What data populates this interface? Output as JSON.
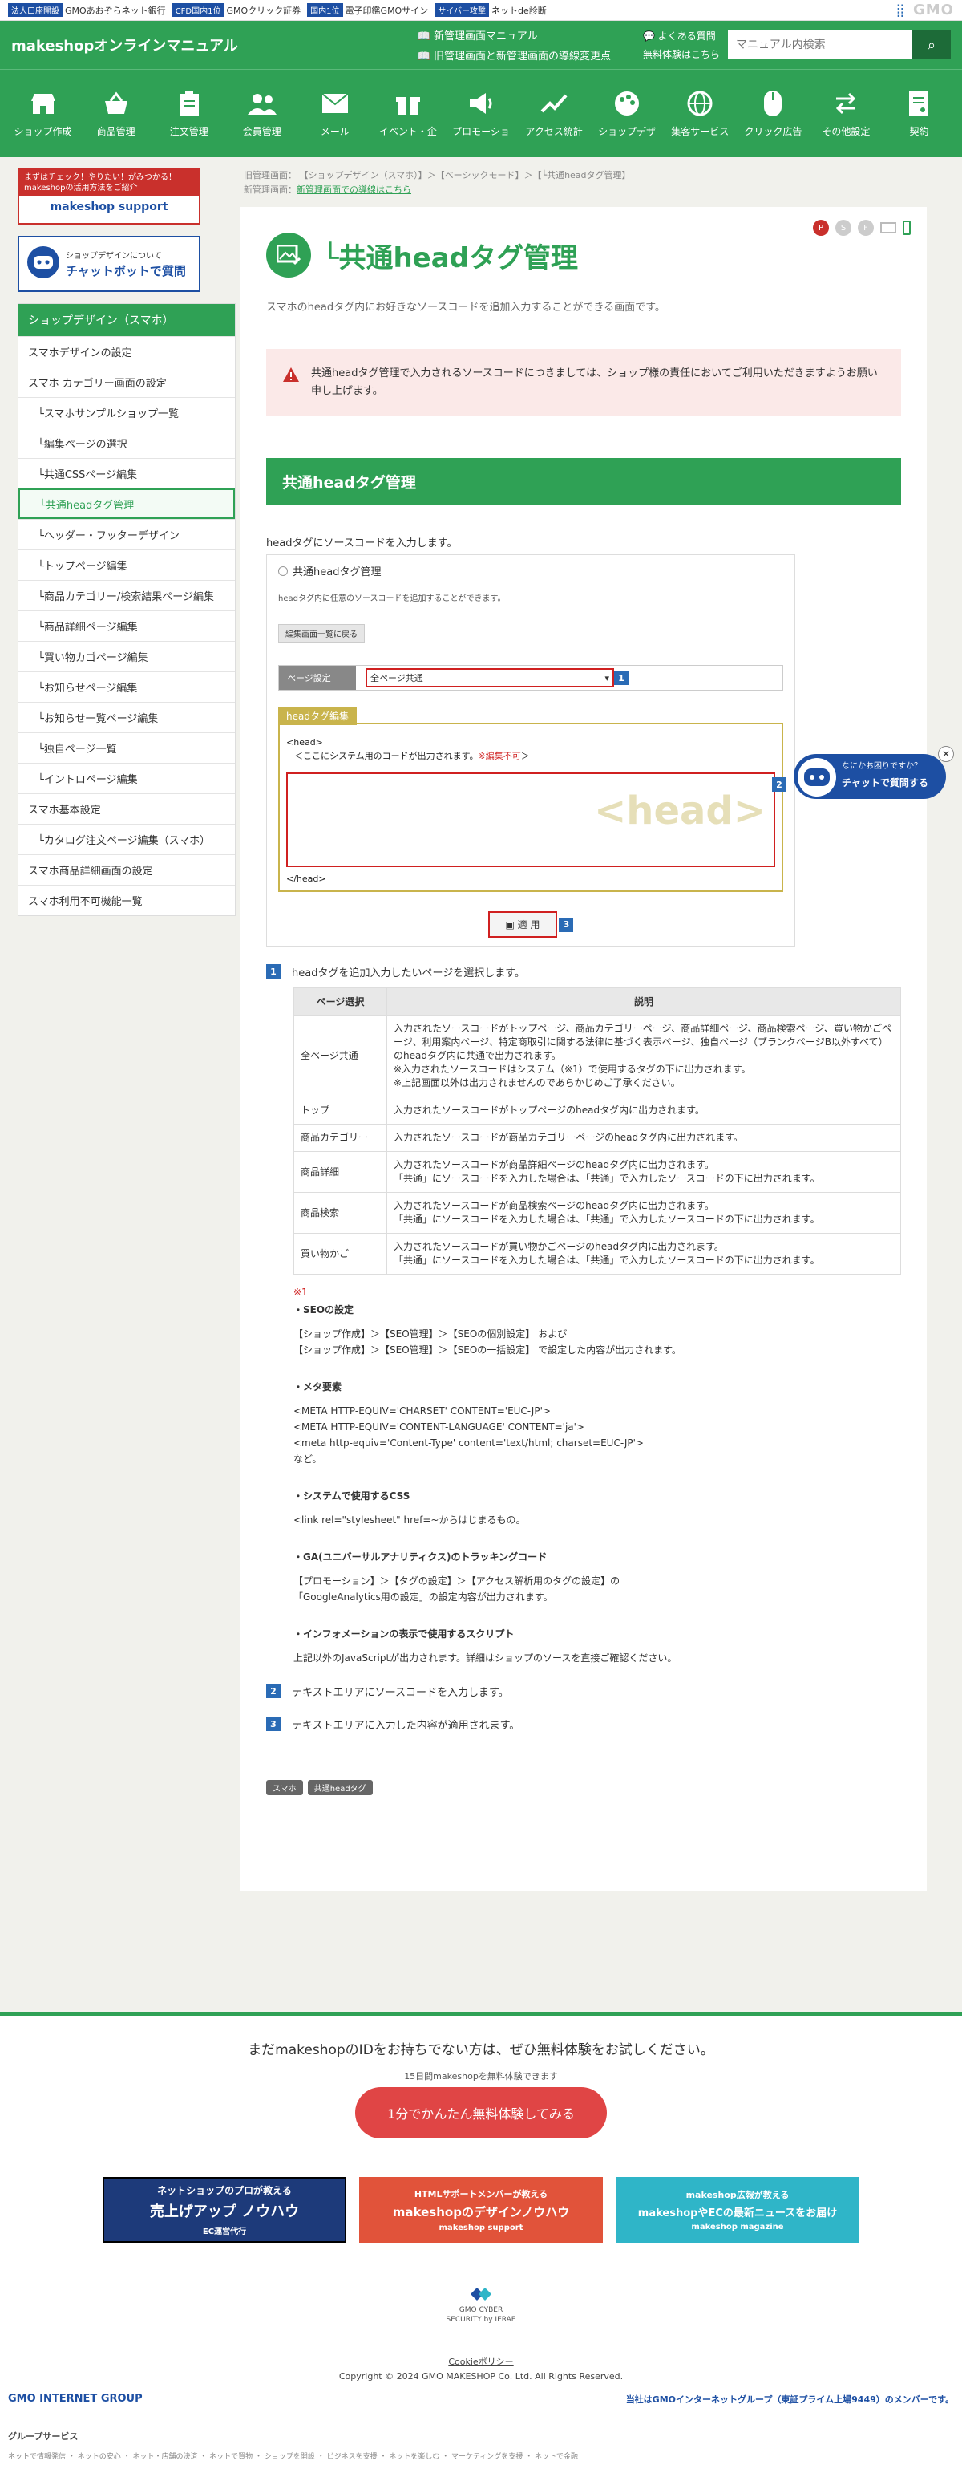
{
  "gmobar": {
    "items": [
      {
        "tag": "法人口座開設",
        "text": "GMOあおぞらネット銀行"
      },
      {
        "tag": "CFD国内1位",
        "text": "GMOクリック証券"
      },
      {
        "tag": "国内1位",
        "text": "電子印鑑GMOサイン"
      },
      {
        "tag": "サイバー攻撃",
        "text": "ネットde診断"
      }
    ],
    "gmo_logo": "GMO"
  },
  "header": {
    "logo": "makeshopオンラインマニュアル",
    "link1": "新管理画面マニュアル",
    "link2": "旧管理画面と新管理画面の導線変更点",
    "faq": "よくある質問",
    "trial": "無料体験はこちら",
    "search_placeholder": "マニュアル内検索"
  },
  "nav": [
    {
      "label": "ショップ作成",
      "icon": "shop-icon"
    },
    {
      "label": "商品管理",
      "icon": "basket-icon"
    },
    {
      "label": "注文管理",
      "icon": "clipboard-icon"
    },
    {
      "label": "会員管理",
      "icon": "users-icon"
    },
    {
      "label": "メール",
      "icon": "mail-icon"
    },
    {
      "label": "イベント・企",
      "icon": "gift-icon"
    },
    {
      "label": "プロモーショ",
      "icon": "megaphone-icon"
    },
    {
      "label": "アクセス統計",
      "icon": "chart-icon"
    },
    {
      "label": "ショップデザ",
      "icon": "palette-icon"
    },
    {
      "label": "集客サービス",
      "icon": "globe-icon"
    },
    {
      "label": "クリック広告",
      "icon": "mouse-icon"
    },
    {
      "label": "その他設定",
      "icon": "arrows-icon"
    },
    {
      "label": "契約",
      "icon": "contract-icon"
    }
  ],
  "sidebar": {
    "banner1_line1": "まずはチェック！やりたい！がみつかる！",
    "banner1_line2": "makeshopの活用方法をご紹介",
    "banner1_brand": "makeshop support",
    "banner2_line1": "ショップデザインについて",
    "banner2_line2": "チャットボットで質問",
    "head": "ショップデザイン（スマホ）",
    "items": [
      {
        "label": "スマホデザインの設定",
        "sub": false
      },
      {
        "label": "スマホ カテゴリー画面の設定",
        "sub": false
      },
      {
        "label": "└スマホサンプルショップ一覧",
        "sub": true
      },
      {
        "label": "└編集ページの選択",
        "sub": true
      },
      {
        "label": "└共通CSSページ編集",
        "sub": true
      },
      {
        "label": "└共通headタグ管理",
        "sub": true,
        "active": true
      },
      {
        "label": "└ヘッダー・フッターデザイン",
        "sub": true
      },
      {
        "label": "└トップページ編集",
        "sub": true
      },
      {
        "label": "└商品カテゴリー/検索結果ページ編集",
        "sub": true
      },
      {
        "label": "└商品詳細ページ編集",
        "sub": true
      },
      {
        "label": "└買い物カゴページ編集",
        "sub": true
      },
      {
        "label": "└お知らせページ編集",
        "sub": true
      },
      {
        "label": "└お知らせ一覧ページ編集",
        "sub": true
      },
      {
        "label": "└独自ページ一覧",
        "sub": true
      },
      {
        "label": "└イントロページ編集",
        "sub": true
      },
      {
        "label": "スマホ基本設定",
        "sub": false
      },
      {
        "label": "└カタログ注文ページ編集（スマホ）",
        "sub": true
      },
      {
        "label": "スマホ商品詳細画面の設定",
        "sub": false
      },
      {
        "label": "スマホ利用不可機能一覧",
        "sub": false
      }
    ]
  },
  "crumbs": {
    "line1": "旧管理画面： 【ショップデザイン（スマホ）】＞【ベーシックモード】＞【└共通headタグ管理】",
    "line2_label": "新管理画面：",
    "line2_link": "新管理画面での導線はこちら"
  },
  "page": {
    "title": "└共通headタグ管理",
    "lead": "スマホのheadタグ内にお好きなソースコードを追加入力することができる画面です。",
    "alert": "共通headタグ管理で入力されるソースコードにつきましては、ショップ様の責任においてご利用いただきますようお願い申し上げます。",
    "h2": "共通headタグ管理",
    "intro": "headタグにソースコードを入力します。"
  },
  "shot": {
    "radio": "共通headタグ管理",
    "desc": "headタグ内に任意のソースコードを追加することができます。",
    "back": "編集画面一覧に戻る",
    "page_label": "ページ設定",
    "page_value": "全ページ共通",
    "tab": "headタグ編集",
    "code1": "<head>",
    "code2": "＜ここにシステム用のコードが出力されます。",
    "code2_red": "※編集不可",
    "code2_end": "＞",
    "code3": "</head>",
    "watermark": "<head>",
    "apply": "適 用",
    "n1": "1",
    "n2": "2",
    "n3": "3"
  },
  "steps": {
    "s1_num": "1",
    "s1": "headタグを追加入力したいページを選択します。",
    "s2_num": "2",
    "s2": "テキストエリアにソースコードを入力します。",
    "s3_num": "3",
    "s3": "テキストエリアに入力した内容が適用されます。"
  },
  "table": {
    "headers": [
      "ページ選択",
      "説明"
    ],
    "rows": [
      [
        "全ページ共通",
        "入力されたソースコードがトップページ、商品カテゴリーページ、商品詳細ページ、商品検索ページ、買い物かごページ、利用案内ページ、特定商取引に関する法律に基づく表示ページ、独自ページ（ブランクページB以外すべて）のheadタグ内に共通で出力されます。\n※入力されたソースコードはシステム（※1）で使用するタグの下に出力されます。\n※上記画面以外は出力されませんのであらかじめご了承ください。"
      ],
      [
        "トップ",
        "入力されたソースコードがトップページのheadタグ内に出力されます。"
      ],
      [
        "商品カテゴリー",
        "入力されたソースコードが商品カテゴリーページのheadタグ内に出力されます。"
      ],
      [
        "商品詳細",
        "入力されたソースコードが商品詳細ページのheadタグ内に出力されます。\n「共通」にソースコードを入力した場合は、「共通」で入力したソースコードの下に出力されます。"
      ],
      [
        "商品検索",
        "入力されたソースコードが商品検索ページのheadタグ内に出力されます。\n「共通」にソースコードを入力した場合は、「共通」で入力したソースコードの下に出力されます。"
      ],
      [
        "買い物かご",
        "入力されたソースコードが買い物かごページのheadタグ内に出力されます。\n「共通」にソースコードを入力した場合は、「共通」で入力したソースコードの下に出力されます。"
      ]
    ]
  },
  "notes": {
    "mark": "※1",
    "seo_h": "・SEOの設定",
    "seo_1": "【ショップ作成】＞【SEO管理】＞【SEOの個別設定】 および",
    "seo_2": "【ショップ作成】＞【SEO管理】＞【SEOの一括設定】 で設定した内容が出力されます。",
    "meta_h": "・メタ要素",
    "meta_1": "<META HTTP-EQUIV='CHARSET' CONTENT='EUC-JP'>",
    "meta_2": "<META HTTP-EQUIV='CONTENT-LANGUAGE' CONTENT='ja'>",
    "meta_3": "<meta http-equiv='Content-Type' content='text/html; charset=EUC-JP'>",
    "meta_4": "など。",
    "css_h": "・システムで使用するCSS",
    "css_1": "<link rel=\"stylesheet\" href=~からはじまるもの。",
    "ga_h": "・GA(ユニバーサルアナリティクス)のトラッキングコード",
    "ga_1": "【プロモーション】＞【タグの設定】＞【アクセス解析用のタグの設定】の",
    "ga_2": "「GoogleAnalytics用の設定」の設定内容が出力されます。",
    "info_h": "・インフォメーションの表示で使用するスクリプト",
    "info_1": "上記以外のJavaScriptが出力されます。詳細はショップのソースを直接ご確認ください。"
  },
  "tags": [
    "スマホ",
    "共通headタグ"
  ],
  "chat_float": {
    "line1": "なにかお困りですか？",
    "line2": "チャットで質問する"
  },
  "footer": {
    "question": "まだmakeshopのIDをお持ちでない方は、ぜひ無料体験をお試しください。",
    "sub": "15日間makeshopを無料体験できます",
    "cta": "1分でかんたん無料体験してみる",
    "b1_top": "ネットショップのプロが教える",
    "b1_main": "売上げアップ ノウハウ",
    "b1_side": "EC運営代行",
    "b2_top": "HTMLサポートメンバーが教える",
    "b2_main": "makeshopのデザインノウハウ",
    "b2_side": "makeshop support",
    "b3_top": "makeshop広報が教える",
    "b3_main": "makeshopやECの最新ニュースをお届け",
    "b3_side": "makeshop magazine",
    "cert": "GMO CYBER SECURITY by IERAE",
    "cookie": "Cookieポリシー",
    "copyright": "Copyright © 2024 GMO MAKESHOP Co. Ltd. All Rights Reserved.",
    "gmo_group": "GMO INTERNET GROUP",
    "gmo_member": "当社はGMOインターネットグループ（東証プライム上場9449）のメンバーです。",
    "group_services": "グループサービス",
    "group_links": "ネットで情報発信 ・ ネットの安心 ・ ネット・店舗の決済 ・ ネットで買物 ・ ショップを開設 ・ ビジネスを支援 ・ ネットを楽しむ ・ マーケティングを支援 ・ ネットで金融"
  },
  "colors": {
    "brand_green": "#2fa155",
    "alert_bg": "#fbe9e8",
    "num_blue": "#2a6bb5",
    "red": "#d02020"
  }
}
